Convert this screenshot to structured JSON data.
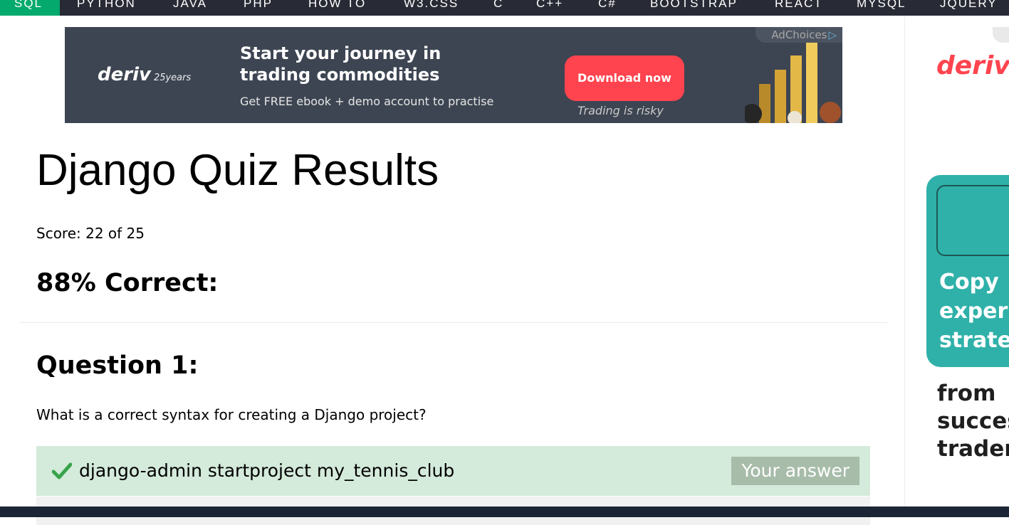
{
  "nav": {
    "items": [
      "SQL",
      "PYTHON",
      "JAVA",
      "PHP",
      "HOW TO",
      "W3.CSS",
      "C",
      "C++",
      "C#",
      "BOOTSTRAP",
      "REACT",
      "MYSQL",
      "JQUERY"
    ],
    "active_index": 0
  },
  "ad_top": {
    "brand": "deriv",
    "brand_years": "25years",
    "headline": "Start your journey in trading commodities",
    "subline": "Get FREE ebook + demo account to practise",
    "cta": "Download now",
    "disclaimer": "Trading is risky",
    "adchoices": "AdChoices"
  },
  "quiz": {
    "title": "Django Quiz Results",
    "score": "Score: 22 of 25",
    "percent": "88% Correct:",
    "question_heading": "Question 1:",
    "question_text": "What is a correct syntax for creating a Django project?",
    "answer_text": "django-admin startproject my_tennis_club",
    "answer_badge": "Your answer"
  },
  "sidebar_ad": {
    "brand": "deriv",
    "copy_line1": "Copy",
    "copy_line2": "experi",
    "copy_line3": "strate",
    "more_line1": "from",
    "more_line2": "succes",
    "more_line3": "trader"
  },
  "colors": {
    "nav_bg": "#282a35",
    "nav_active": "#04aa6d",
    "correct_bg": "#d4eadb",
    "badge_bg": "#a7bca9",
    "check": "#38a34a",
    "deriv_red": "#ff444f"
  }
}
